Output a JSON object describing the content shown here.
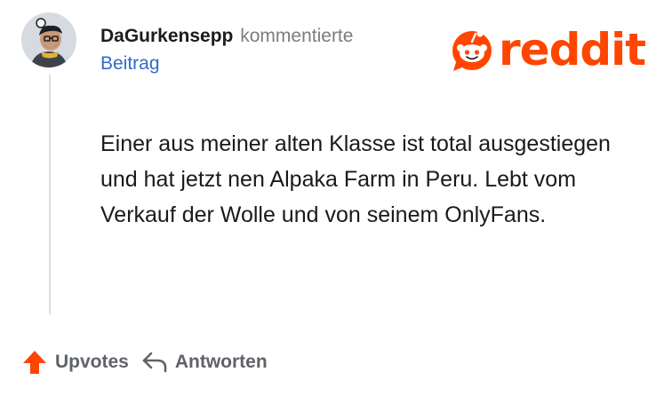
{
  "comment": {
    "username": "DaGurkensepp",
    "action": "kommentierte",
    "post_link": "Beitrag",
    "text": "Einer aus meiner alten Klasse ist total ausgestiegen und hat jetzt nen Alpaka Farm in Peru. Lebt vom Verkauf der Wolle und von seinem OnlyFans."
  },
  "brand": {
    "name": "reddit",
    "color": "#ff4500"
  },
  "actions": {
    "upvote_label": "Upvotes",
    "reply_label": "Antworten"
  },
  "icons": {
    "upvote": "upvote-arrow-icon",
    "reply": "reply-arrow-icon",
    "logo": "reddit-snoo-icon"
  },
  "colors": {
    "upvote_active": "#ff4500",
    "link": "#2f6bc9",
    "muted": "#7c7c7c"
  }
}
